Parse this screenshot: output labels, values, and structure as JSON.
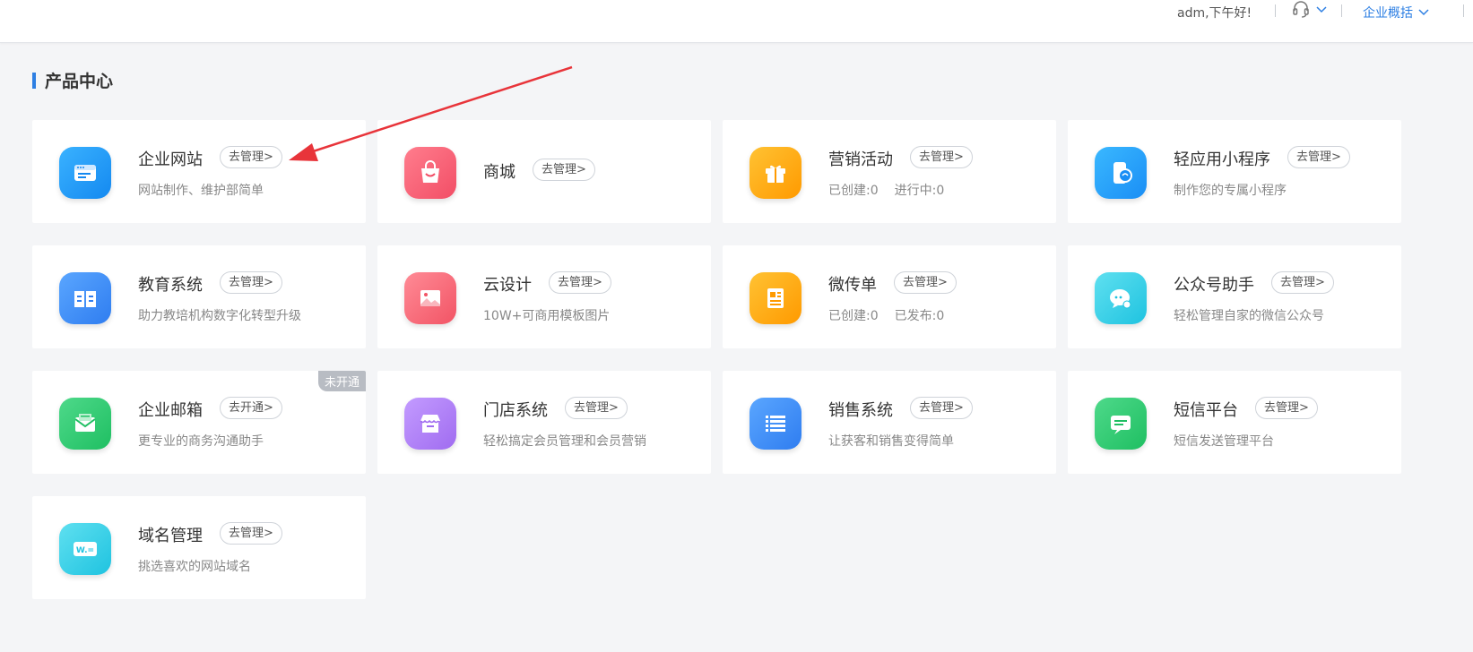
{
  "header": {
    "greeting": "adm,下午好!",
    "overview_label": "企业概括",
    "edge_text": "≥"
  },
  "section": {
    "title": "产品中心"
  },
  "cards": [
    {
      "name": "企业网站",
      "button": "去管理>",
      "desc": "网站制作、维护部简单",
      "icon": "website-icon",
      "color_from": "#3ab2ff",
      "color_to": "#1489f0"
    },
    {
      "name": "商城",
      "button": "去管理>",
      "desc": "",
      "icon": "shopping-bag-icon",
      "color_from": "#ff7d8d",
      "color_to": "#f24e66"
    },
    {
      "name": "营销活动",
      "button": "去管理>",
      "stat1": "已创建:0",
      "stat2": "进行中:0",
      "icon": "gift-icon",
      "color_from": "#ffc233",
      "color_to": "#ff9a00"
    },
    {
      "name": "轻应用小程序",
      "button": "去管理>",
      "desc": "制作您的专属小程序",
      "icon": "mini-program-icon",
      "color_from": "#3ab8ff",
      "color_to": "#1a8ef5"
    },
    {
      "name": "教育系统",
      "button": "去管理>",
      "desc": "助力教培机构数字化转型升级",
      "icon": "book-icon",
      "color_from": "#5aa6ff",
      "color_to": "#2f7df0"
    },
    {
      "name": "云设计",
      "button": "去管理>",
      "desc": "10W+可商用模板图片",
      "icon": "image-icon",
      "color_from": "#ff8b96",
      "color_to": "#f25465"
    },
    {
      "name": "微传单",
      "button": "去管理>",
      "stat1": "已创建:0",
      "stat2": "已发布:0",
      "icon": "flyer-icon",
      "color_from": "#ffc233",
      "color_to": "#ff9a00"
    },
    {
      "name": "公众号助手",
      "button": "去管理>",
      "desc": "轻松管理自家的微信公众号",
      "icon": "wechat-icon",
      "color_from": "#5fe0f0",
      "color_to": "#1fc3e0"
    },
    {
      "name": "企业邮箱",
      "button": "去开通>",
      "desc": "更专业的商务沟通助手",
      "badge": "未开通",
      "icon": "mail-icon",
      "color_from": "#4ed98a",
      "color_to": "#1fbf62"
    },
    {
      "name": "门店系统",
      "button": "去管理>",
      "desc": "轻松搞定会员管理和会员营销",
      "icon": "store-icon",
      "color_from": "#c39bff",
      "color_to": "#a06cf0"
    },
    {
      "name": "销售系统",
      "button": "去管理>",
      "desc": "让获客和销售变得简单",
      "icon": "list-icon",
      "color_from": "#5aa6ff",
      "color_to": "#2f7df0"
    },
    {
      "name": "短信平台",
      "button": "去管理>",
      "desc": "短信发送管理平台",
      "icon": "sms-icon",
      "color_from": "#4ed98a",
      "color_to": "#1fbf62"
    },
    {
      "name": "域名管理",
      "button": "去管理>",
      "desc": "挑选喜欢的网站域名",
      "icon": "domain-icon",
      "color_from": "#5fe0f0",
      "color_to": "#1fc3e0"
    }
  ],
  "domain_icon_text": "W.="
}
